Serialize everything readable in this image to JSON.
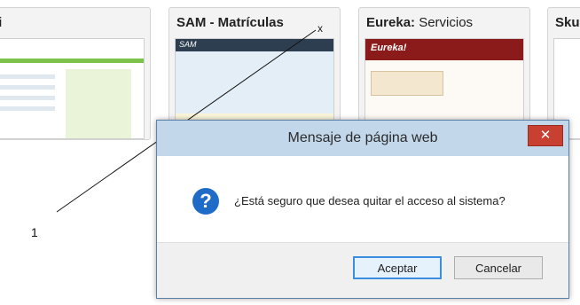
{
  "thumbnails": [
    {
      "bold": "di",
      "rest": ""
    },
    {
      "bold": "SAM - Matrículas",
      "rest": ""
    },
    {
      "bold": "Eureka:",
      "rest": " Servicios"
    },
    {
      "bold": "Sku",
      "rest": ""
    }
  ],
  "thumb2": {
    "brand": "SAM"
  },
  "thumb3": {
    "brand": "Eureka!"
  },
  "tile_close": "x",
  "callout": {
    "label": "1"
  },
  "dialog": {
    "title": "Mensaje de página web",
    "close_glyph": "✕",
    "icon_glyph": "?",
    "message": "¿Está seguro que desea quitar el acceso al sistema?",
    "ok_label": "Aceptar",
    "cancel_label": "Cancelar"
  },
  "colors": {
    "titlebar": "#c2d7ea",
    "close_button": "#c84031",
    "question_icon": "#1f6cc8",
    "ok_border": "#3c8ee0"
  }
}
